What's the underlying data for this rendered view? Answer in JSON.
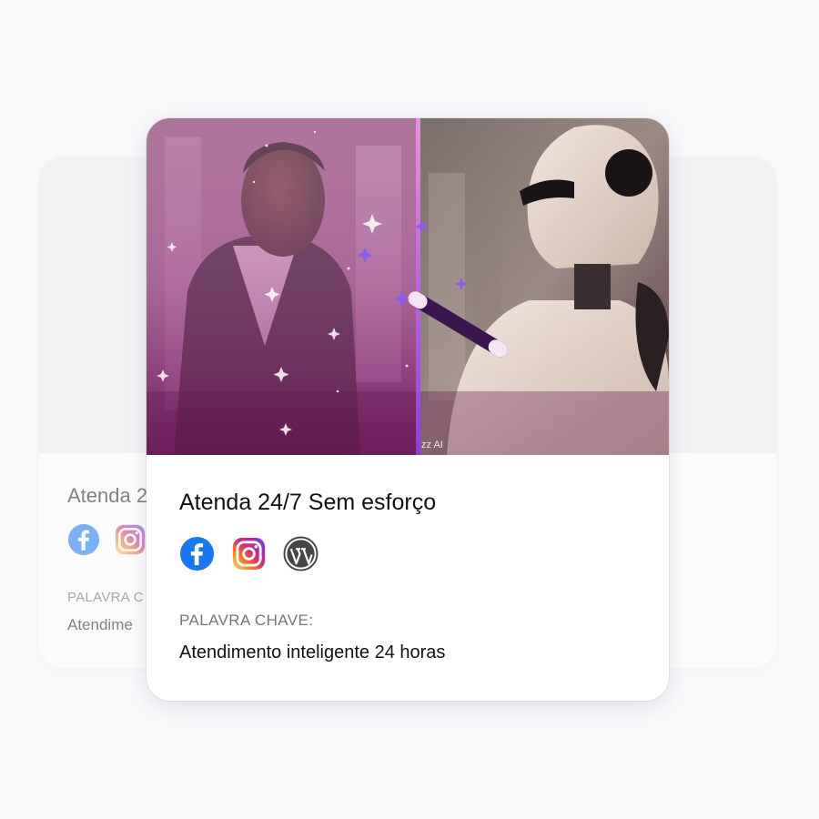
{
  "back_card": {
    "title": "Atenda 2",
    "keyword_label": "PALAVRA C",
    "keyword_value": "Atendime",
    "icons": [
      "facebook-icon",
      "instagram-icon"
    ]
  },
  "front_card": {
    "image": {
      "watermark": "zz AI"
    },
    "title": "Atenda 24/7 Sem esforço",
    "social_icons": [
      "facebook-icon",
      "instagram-icon",
      "wordpress-icon"
    ],
    "keyword_label": "PALAVRA CHAVE:",
    "keyword_value": "Atendimento inteligente 24 horas"
  },
  "colors": {
    "page_background": "#f8f8fa",
    "facebook": "#1877f2",
    "wordpress": "#464646",
    "divider_accent": "#b36bff"
  }
}
